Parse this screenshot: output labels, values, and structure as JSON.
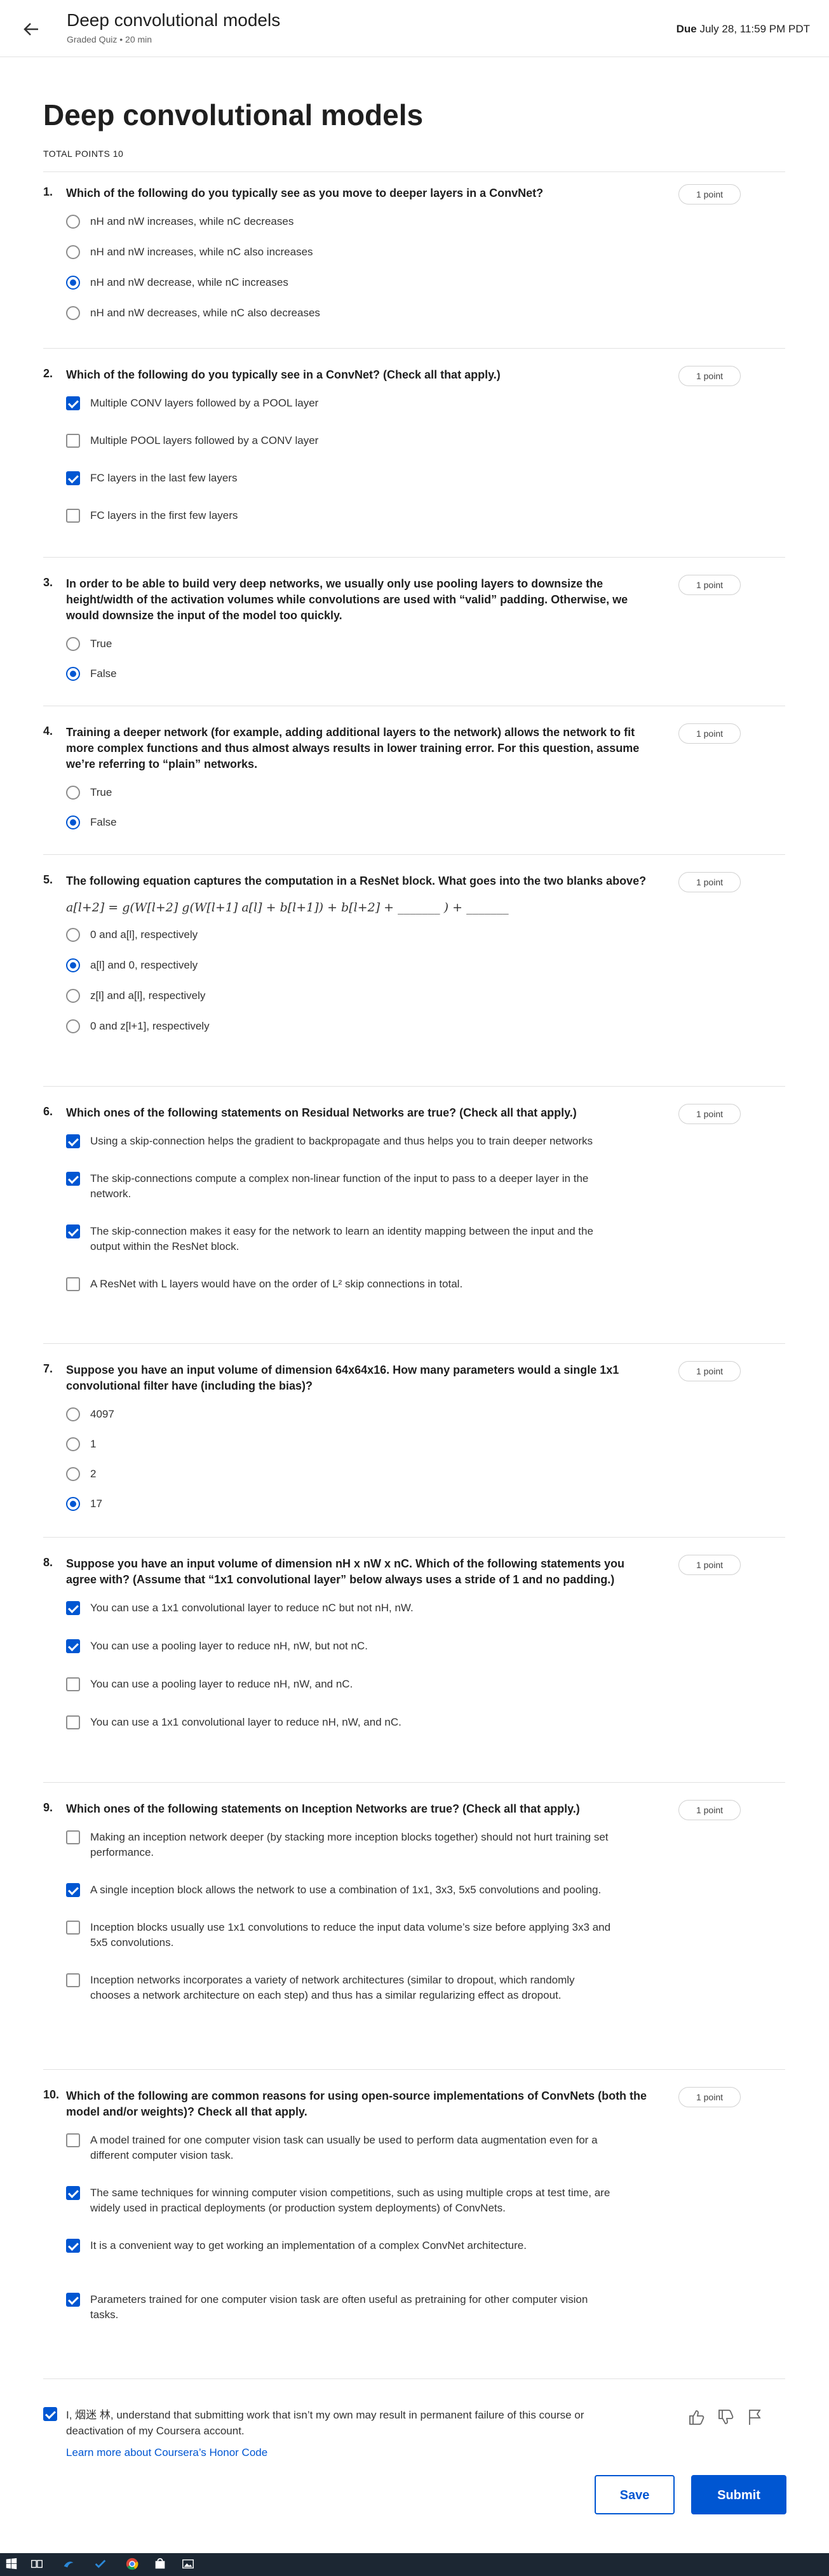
{
  "header": {
    "course_title": "Deep convolutional models",
    "subtitle": "Graded Quiz • 20 min",
    "due_label": "Due",
    "due_date": "July 28, 11:59 PM PDT"
  },
  "page": {
    "title": "Deep convolutional models",
    "total_points": "TOTAL POINTS 10"
  },
  "colors": {
    "accent": "#0056d2",
    "divider": "#e1e1e1",
    "taskbar": "#1c2733"
  },
  "questions": [
    {
      "num": "1.",
      "text": "Which of the following do you typically see as you move to deeper layers in a ConvNet?",
      "points": "1 point",
      "type": "radio",
      "options": [
        {
          "text": "nH and nW increases, while nC decreases",
          "selected": false
        },
        {
          "text": "nH and nW increases, while nC also increases",
          "selected": false
        },
        {
          "text": "nH and nW decrease, while nC increases",
          "selected": true
        },
        {
          "text": "nH and nW decreases, while nC also decreases",
          "selected": false
        }
      ]
    },
    {
      "num": "2.",
      "text": "Which of the following do you typically see in a ConvNet? (Check all that apply.)",
      "points": "1 point",
      "type": "check",
      "options": [
        {
          "text": "Multiple CONV layers followed by a POOL layer",
          "selected": true
        },
        {
          "text": "Multiple POOL layers followed by a CONV layer",
          "selected": false
        },
        {
          "text": "FC layers in the last few layers",
          "selected": true
        },
        {
          "text": "FC layers in the first few layers",
          "selected": false
        }
      ]
    },
    {
      "num": "3.",
      "text": "In order to be able to build very deep networks, we usually only use pooling layers to downsize the height/width of the activation volumes while convolutions are used with “valid” padding. Otherwise, we would downsize the input of the model too quickly.",
      "points": "1 point",
      "type": "radio",
      "options": [
        {
          "text": "True",
          "selected": false
        },
        {
          "text": "False",
          "selected": true
        }
      ]
    },
    {
      "num": "4.",
      "text": "Training a deeper network (for example, adding additional layers to the network) allows the network to fit more complex functions and thus almost always results in lower training error. For this question, assume we’re referring to “plain” networks.",
      "points": "1 point",
      "type": "radio",
      "options": [
        {
          "text": "True",
          "selected": false
        },
        {
          "text": "False",
          "selected": true
        }
      ]
    },
    {
      "num": "5.",
      "text": "The following equation captures the computation in a ResNet block. What goes into the two blanks above?",
      "points": "1 point",
      "type": "radio",
      "formula": "a[l+2] = g(W[l+2] g(W[l+1] a[l] + b[l+1]) + b[l+2] + _______ ) + _______",
      "options": [
        {
          "text": "0 and a[l], respectively",
          "selected": false
        },
        {
          "text": "a[l] and 0, respectively",
          "selected": true
        },
        {
          "text": "z[l] and a[l], respectively",
          "selected": false
        },
        {
          "text": "0 and z[l+1], respectively",
          "selected": false
        }
      ]
    },
    {
      "num": "6.",
      "text": "Which ones of the following statements on Residual Networks are true? (Check all that apply.)",
      "points": "1 point",
      "type": "check",
      "options": [
        {
          "text": "Using a skip-connection helps the gradient to backpropagate and thus helps you to train deeper networks",
          "selected": true
        },
        {
          "text": "The skip-connections compute a complex non-linear function of the input to pass to a deeper layer in the network.",
          "selected": true
        },
        {
          "text": "The skip-connection makes it easy for the network to learn an identity mapping between the input and the output within the ResNet block.",
          "selected": true
        },
        {
          "text": "A ResNet with L layers would have on the order of L² skip connections in total.",
          "selected": false
        }
      ]
    },
    {
      "num": "7.",
      "text": "Suppose you have an input volume of dimension 64x64x16. How many parameters would a single 1x1 convolutional filter have (including the bias)?",
      "points": "1 point",
      "type": "radio",
      "options": [
        {
          "text": "4097",
          "selected": false
        },
        {
          "text": "1",
          "selected": false
        },
        {
          "text": "2",
          "selected": false
        },
        {
          "text": "17",
          "selected": true
        }
      ]
    },
    {
      "num": "8.",
      "text": "Suppose you have an input volume of dimension nH x nW x nC. Which of the following statements you agree with? (Assume that “1x1 convolutional layer” below always uses a stride of 1 and no padding.)",
      "points": "1 point",
      "type": "check",
      "options": [
        {
          "text": "You can use a 1x1 convolutional layer to reduce nC but not nH, nW.",
          "selected": true
        },
        {
          "text": "You can use a pooling layer to reduce nH, nW, but not nC.",
          "selected": true
        },
        {
          "text": "You can use a pooling layer to reduce nH, nW, and nC.",
          "selected": false
        },
        {
          "text": "You can use a 1x1 convolutional layer to reduce nH, nW, and nC.",
          "selected": false
        }
      ]
    },
    {
      "num": "9.",
      "text": "Which ones of the following statements on Inception Networks are true? (Check all that apply.)",
      "points": "1 point",
      "type": "check",
      "options": [
        {
          "text": "Making an inception network deeper (by stacking more inception blocks together) should not hurt training set performance.",
          "selected": false
        },
        {
          "text": "A single inception block allows the network to use a combination of 1x1, 3x3, 5x5 convolutions and pooling.",
          "selected": true
        },
        {
          "text": "Inception blocks usually use 1x1 convolutions to reduce the input data volume’s size before applying 3x3 and 5x5 convolutions.",
          "selected": false
        },
        {
          "text": "Inception networks incorporates a variety of network architectures (similar to dropout, which randomly chooses a network architecture on each step) and thus has a similar regularizing effect as dropout.",
          "selected": false
        }
      ]
    },
    {
      "num": "10.",
      "text": "Which of the following are common reasons for using open-source implementations of ConvNets (both the model and/or weights)? Check all that apply.",
      "points": "1 point",
      "type": "check",
      "options": [
        {
          "text": "A model trained for one computer vision task can usually be used to perform data augmentation even for a different computer vision task.",
          "selected": false
        },
        {
          "text": "The same techniques for winning computer vision competitions, such as using multiple crops at test time, are widely used in practical deployments (or production system deployments) of ConvNets.",
          "selected": true
        },
        {
          "text": "It is a convenient way to get working an implementation of a complex ConvNet architecture.",
          "selected": true
        },
        {
          "text": "Parameters trained for one computer vision task are often useful as pretraining for other computer vision tasks.",
          "selected": true
        }
      ]
    }
  ],
  "honor": {
    "text": "I, 烟迷 林, understand that submitting work that isn’t my own may result in permanent failure of this course or deactivation of my Coursera account.",
    "link": "Learn more about Coursera’s Honor Code",
    "checked": true
  },
  "actions": {
    "save": "Save",
    "submit": "Submit"
  },
  "icons": {
    "back": "arrow-left-icon",
    "like": "thumbs-up-icon",
    "dislike": "thumbs-down-icon",
    "flag": "flag-icon"
  }
}
